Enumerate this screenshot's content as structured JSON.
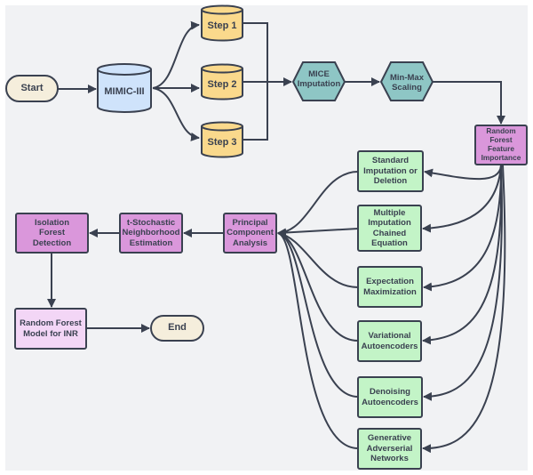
{
  "diagram": {
    "colors": {
      "canvas": "#F1F2F4",
      "stroke": "#3A4150",
      "terminal": "#F5EEDC",
      "database": "#CFE3FB",
      "step": "#FAD98C",
      "process_hex": "#8EC6C5",
      "pink": "#DA97DB",
      "light_pink": "#F3D6F6",
      "green": "#C3F4C7"
    },
    "nodes": {
      "start": "Start",
      "mimic": "MIMIC-III",
      "step1": "Step 1",
      "step2": "Step 2",
      "step3": "Step 3",
      "mice": "MICE\nImputation",
      "minmax": "Min-Max\nScaling",
      "rffi": "Random\nForest\nFeature\nImportance",
      "standard": "Standard\nImputation or\nDeletion",
      "multiple": "Multiple\nImputation\nChained\nEquation",
      "em": "Expectation\nMaximization",
      "vae": "Variational\nAutoencoders",
      "dae": "Denoising\nAutoencoders",
      "gan": "Generative\nAdverserial\nNetworks",
      "pca": "Principal\nComponent\nAnalysis",
      "tsne": "t-Stochastic\nNeighborhood\nEstimation",
      "iforest": "Isolation\nForest\nDetection",
      "rfmodel": "Random Forest\nModel for INR",
      "end": "End"
    },
    "edges": [
      {
        "from": "start",
        "to": "mimic"
      },
      {
        "from": "mimic",
        "to": "step1"
      },
      {
        "from": "mimic",
        "to": "step2"
      },
      {
        "from": "mimic",
        "to": "step3"
      },
      {
        "from": "step1",
        "to": "mice"
      },
      {
        "from": "step2",
        "to": "mice"
      },
      {
        "from": "step3",
        "to": "mice"
      },
      {
        "from": "mice",
        "to": "minmax"
      },
      {
        "from": "minmax",
        "to": "rffi"
      },
      {
        "from": "rffi",
        "to": "standard"
      },
      {
        "from": "rffi",
        "to": "multiple"
      },
      {
        "from": "rffi",
        "to": "em"
      },
      {
        "from": "rffi",
        "to": "vae"
      },
      {
        "from": "rffi",
        "to": "dae"
      },
      {
        "from": "rffi",
        "to": "gan"
      },
      {
        "from": "standard",
        "to": "pca"
      },
      {
        "from": "multiple",
        "to": "pca"
      },
      {
        "from": "em",
        "to": "pca"
      },
      {
        "from": "vae",
        "to": "pca"
      },
      {
        "from": "dae",
        "to": "pca"
      },
      {
        "from": "gan",
        "to": "pca"
      },
      {
        "from": "pca",
        "to": "tsne"
      },
      {
        "from": "tsne",
        "to": "iforest"
      },
      {
        "from": "iforest",
        "to": "rfmodel"
      },
      {
        "from": "rfmodel",
        "to": "end"
      }
    ]
  }
}
